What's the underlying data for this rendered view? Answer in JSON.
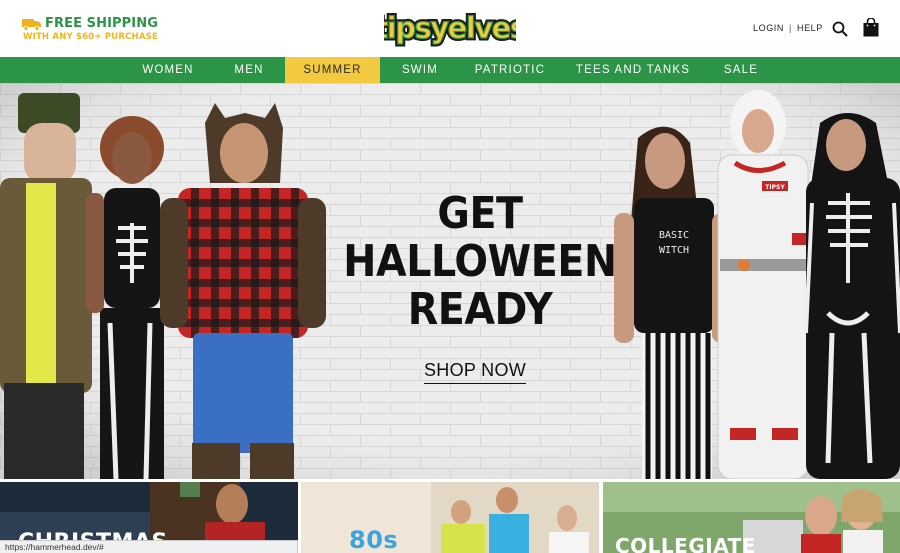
{
  "header": {
    "shipping": {
      "title": "FREE SHIPPING",
      "subtitle": "WITH ANY $60+ PURCHASE"
    },
    "logo_text": "tipsyelves",
    "login_label": "LOGIN",
    "separator": "|",
    "help_label": "HELP",
    "search_icon": "search-icon",
    "cart_icon": "shopping-bag-icon"
  },
  "nav": {
    "items": [
      {
        "label": "WOMEN",
        "active": false
      },
      {
        "label": "MEN",
        "active": false
      },
      {
        "label": "SUMMER",
        "active": true
      },
      {
        "label": "SWIM",
        "active": false
      },
      {
        "label": "PATRIOTIC",
        "active": false
      },
      {
        "label": "TEES AND TANKS",
        "active": false
      },
      {
        "label": "SALE",
        "active": false
      }
    ]
  },
  "hero": {
    "headline": [
      "GET",
      "HALLOWEEN",
      "READY"
    ],
    "cta_label": "SHOP NOW",
    "shirt_text_left": "BASIC",
    "shirt_text_right": "WITCH",
    "badge_text": "TIPSY"
  },
  "tiles": [
    {
      "label": "CHRISTMAS"
    },
    {
      "label": "80s"
    },
    {
      "label": "COLLEGIATE"
    }
  ],
  "status_bar": {
    "url": "https://hammerhead.dev/#"
  },
  "colors": {
    "brand_green": "#2c9447",
    "accent_yellow": "#f2c93f",
    "shipping_yellow": "#f2b21c"
  }
}
